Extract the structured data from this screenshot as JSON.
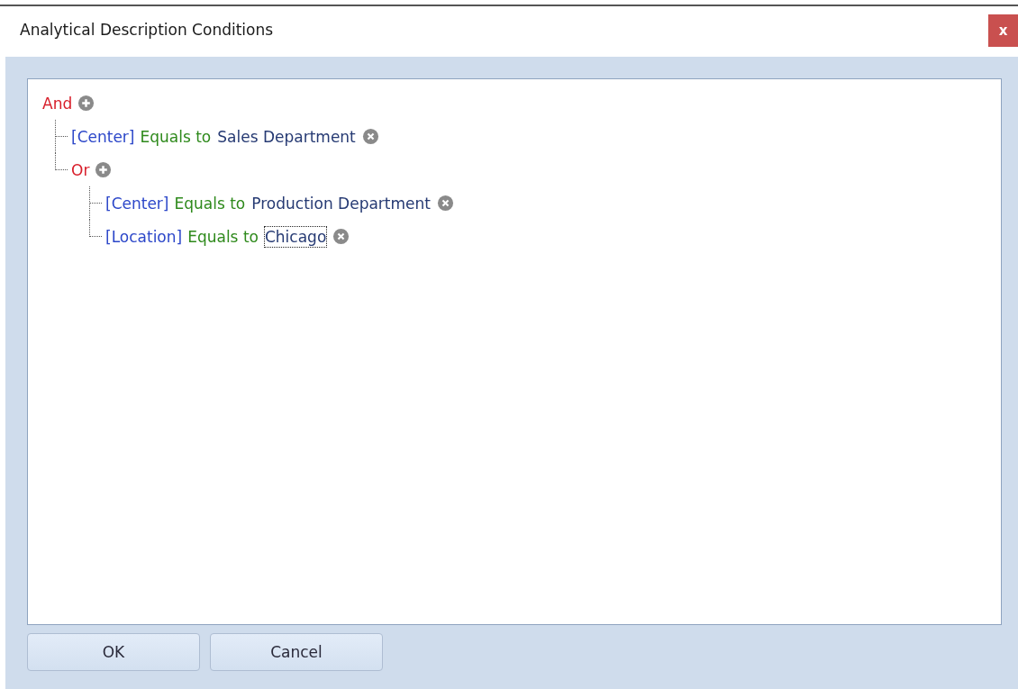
{
  "window": {
    "title": "Analytical Description Conditions",
    "close": "x"
  },
  "tree": {
    "kind": "group",
    "label": "And",
    "children": [
      {
        "kind": "condition",
        "field": "[Center]",
        "operator": "Equals to",
        "value": "Sales Department",
        "focused": false
      },
      {
        "kind": "group",
        "label": "Or",
        "children": [
          {
            "kind": "condition",
            "field": "[Center]",
            "operator": "Equals to",
            "value": "Production Department",
            "focused": false
          },
          {
            "kind": "condition",
            "field": "[Location]",
            "operator": "Equals to",
            "value": "Chicago",
            "focused": true
          }
        ]
      }
    ]
  },
  "buttons": [
    "OK",
    "Cancel"
  ]
}
